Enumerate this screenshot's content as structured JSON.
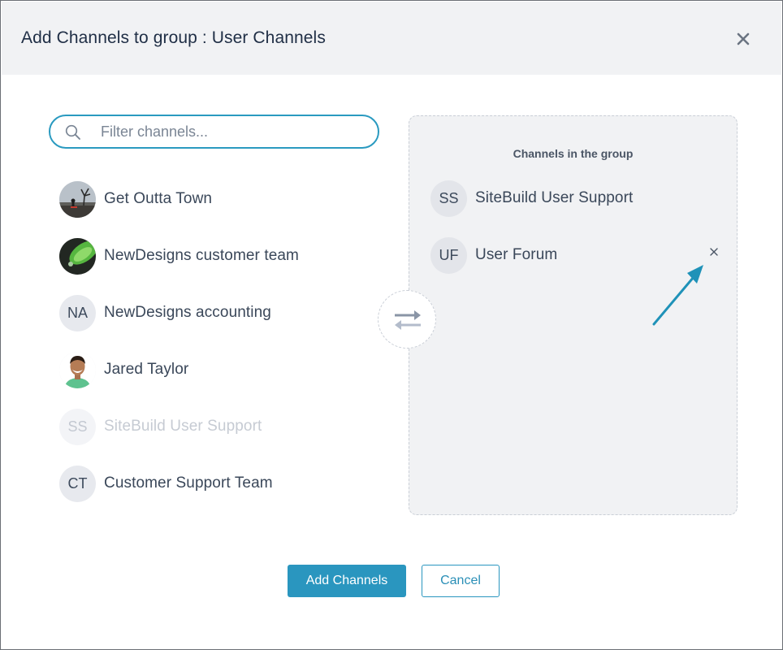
{
  "dialog": {
    "title": "Add Channels to group : User Channels"
  },
  "search": {
    "placeholder": "Filter channels..."
  },
  "available_channels": [
    {
      "label": "Get Outta Town",
      "avatar": "photo",
      "state": "enabled"
    },
    {
      "label": "NewDesigns customer team",
      "avatar": "photo",
      "state": "enabled"
    },
    {
      "label": "NewDesigns accounting",
      "avatar_initials": "NA",
      "state": "enabled"
    },
    {
      "label": "Jared Taylor",
      "avatar": "photo",
      "state": "enabled"
    },
    {
      "label": "SiteBuild User Support",
      "avatar_initials": "SS",
      "state": "disabled"
    },
    {
      "label": "Customer Support Team",
      "avatar_initials": "CT",
      "state": "enabled"
    }
  ],
  "group_panel": {
    "title": "Channels in the group",
    "items": [
      {
        "label": "SiteBuild User Support",
        "avatar_initials": "SS"
      },
      {
        "label": "User Forum",
        "avatar_initials": "UF",
        "remove_icon": "close-icon"
      }
    ]
  },
  "footer": {
    "add_label": "Add Channels",
    "cancel_label": "Cancel"
  },
  "colors": {
    "accent": "#2a96bf",
    "header_bg": "#f1f2f4",
    "panel_bg": "#f1f2f4",
    "annotation_arrow": "#1f92b8"
  },
  "icons": {
    "close": "close-icon",
    "search": "search-icon",
    "transfer": "swap-arrows-icon"
  }
}
